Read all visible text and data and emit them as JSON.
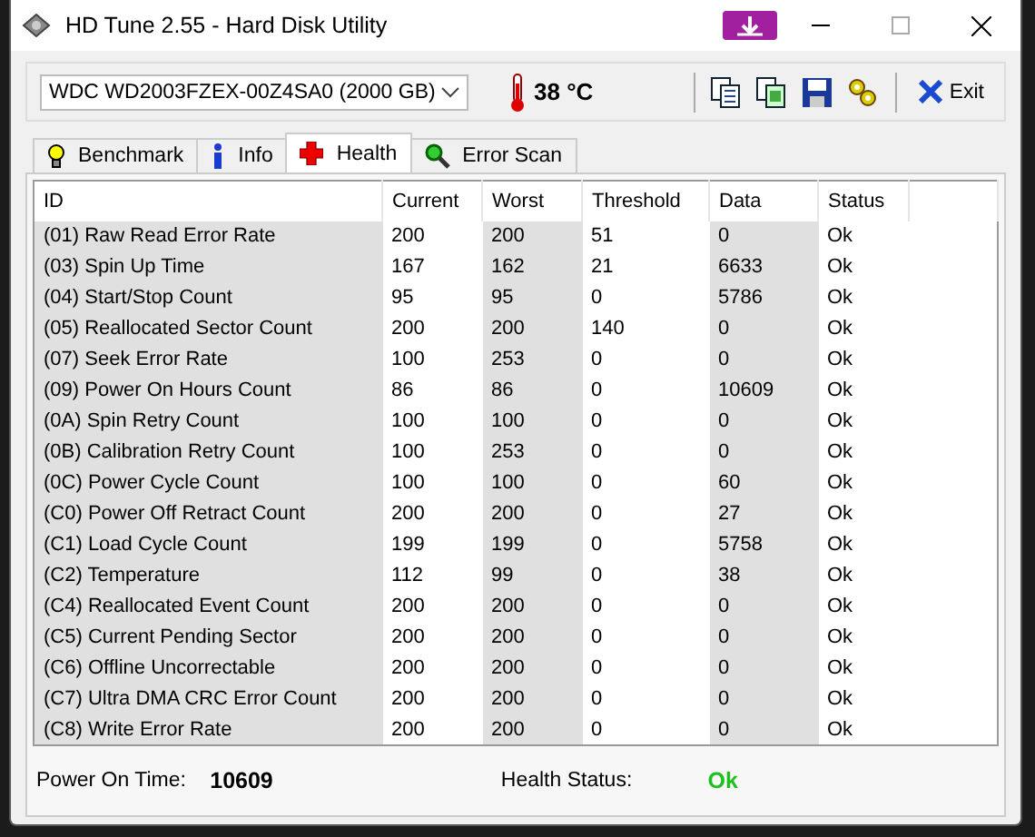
{
  "window": {
    "title": "HD Tune 2.55 - Hard Disk Utility"
  },
  "toolbar": {
    "drive": "WDC WD2003FZEX-00Z4SA0 (2000 GB)",
    "temperature": "38 °C",
    "exit_label": "Exit"
  },
  "tabs": [
    {
      "label": "Benchmark",
      "selected": false
    },
    {
      "label": "Info",
      "selected": false
    },
    {
      "label": "Health",
      "selected": true
    },
    {
      "label": "Error Scan",
      "selected": false
    }
  ],
  "table": {
    "columns": [
      "ID",
      "Current",
      "Worst",
      "Threshold",
      "Data",
      "Status"
    ],
    "rows": [
      [
        "(01) Raw Read Error Rate",
        "200",
        "200",
        "51",
        "0",
        "Ok"
      ],
      [
        "(03) Spin Up Time",
        "167",
        "162",
        "21",
        "6633",
        "Ok"
      ],
      [
        "(04) Start/Stop Count",
        "95",
        "95",
        "0",
        "5786",
        "Ok"
      ],
      [
        "(05) Reallocated Sector Count",
        "200",
        "200",
        "140",
        "0",
        "Ok"
      ],
      [
        "(07) Seek Error Rate",
        "100",
        "253",
        "0",
        "0",
        "Ok"
      ],
      [
        "(09) Power On Hours Count",
        "86",
        "86",
        "0",
        "10609",
        "Ok"
      ],
      [
        "(0A) Spin Retry Count",
        "100",
        "100",
        "0",
        "0",
        "Ok"
      ],
      [
        "(0B) Calibration Retry Count",
        "100",
        "253",
        "0",
        "0",
        "Ok"
      ],
      [
        "(0C) Power Cycle Count",
        "100",
        "100",
        "0",
        "60",
        "Ok"
      ],
      [
        "(C0) Power Off Retract Count",
        "200",
        "200",
        "0",
        "27",
        "Ok"
      ],
      [
        "(C1) Load Cycle Count",
        "199",
        "199",
        "0",
        "5758",
        "Ok"
      ],
      [
        "(C2) Temperature",
        "112",
        "99",
        "0",
        "38",
        "Ok"
      ],
      [
        "(C4) Reallocated Event Count",
        "200",
        "200",
        "0",
        "0",
        "Ok"
      ],
      [
        "(C5) Current Pending Sector",
        "200",
        "200",
        "0",
        "0",
        "Ok"
      ],
      [
        "(C6) Offline Uncorrectable",
        "200",
        "200",
        "0",
        "0",
        "Ok"
      ],
      [
        "(C7) Ultra DMA CRC Error Count",
        "200",
        "200",
        "0",
        "0",
        "Ok"
      ],
      [
        "(C8) Write Error Rate",
        "200",
        "200",
        "0",
        "0",
        "Ok"
      ]
    ]
  },
  "footer": {
    "power_on_label": "Power On Time:",
    "power_on_value": "10609",
    "health_label": "Health Status:",
    "health_value": "Ok"
  }
}
